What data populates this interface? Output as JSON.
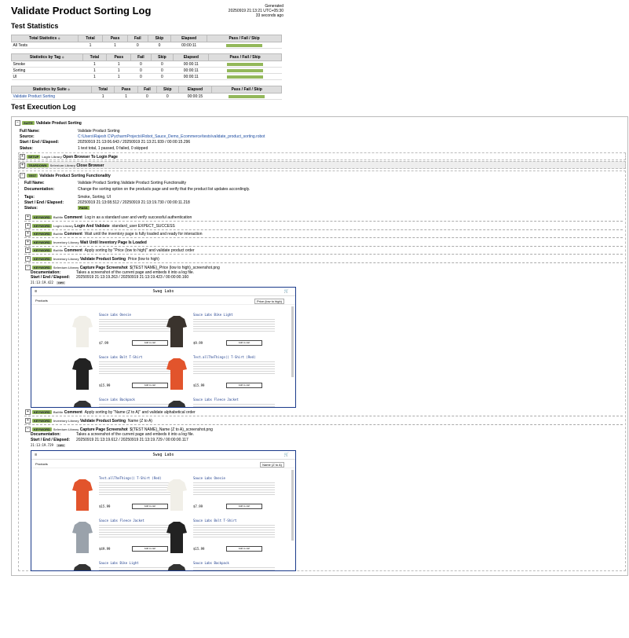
{
  "page": {
    "title": "Validate Product Sorting Log",
    "generated_label": "Generated",
    "generated_time": "20250919 21:13:21 UTC+05:30",
    "generated_ago": "33 seconds ago"
  },
  "sections": {
    "stats": "Test Statistics",
    "log": "Test Execution Log"
  },
  "stats": {
    "headers": [
      "Total",
      "Pass",
      "Fail",
      "Skip",
      "Elapsed",
      "Pass / Fail / Skip"
    ],
    "total": {
      "title": "Total Statistics",
      "rows": [
        {
          "name": "All Tests",
          "total": "1",
          "pass": "1",
          "fail": "0",
          "skip": "0",
          "elapsed": "00:00:11"
        }
      ]
    },
    "tag": {
      "title": "Statistics by Tag",
      "rows": [
        {
          "name": "Smoke",
          "total": "1",
          "pass": "1",
          "fail": "0",
          "skip": "0",
          "elapsed": "00:00:11"
        },
        {
          "name": "Sorting",
          "total": "1",
          "pass": "1",
          "fail": "0",
          "skip": "0",
          "elapsed": "00:00:11"
        },
        {
          "name": "UI",
          "total": "1",
          "pass": "1",
          "fail": "0",
          "skip": "0",
          "elapsed": "00:00:11"
        }
      ]
    },
    "suite": {
      "title": "Statistics by Suite",
      "rows": [
        {
          "name": "Validate Product Sorting",
          "total": "1",
          "pass": "1",
          "fail": "0",
          "skip": "0",
          "elapsed": "00:00:15"
        }
      ]
    },
    "bar_color": "#93b85a"
  },
  "suite": {
    "label": "SUITE",
    "name": "Validate Product Sorting",
    "full_name_label": "Full Name:",
    "full_name": "Validate Product Sorting",
    "source_label": "Source:",
    "source": "C:\\Users\\Rajesh C\\PycharmProjects\\Robot_Sauce_Demo_Ecommerce\\tests\\validate_product_sorting.robot",
    "time_label": "Start / End / Elapsed:",
    "time": "20250919 21:13:06.643 / 20250919 21:13:21.939 / 00:00:15.296",
    "status_label": "Status:",
    "status": "1 test total, 1 passed, 0 failed, 0 skipped",
    "setup": {
      "label": "SETUP",
      "lib": "Login Library",
      "name": "Open Browser To Login Page"
    },
    "teardown": {
      "label": "TEARDOWN",
      "lib": "Selenium Library",
      "name": "Close Browser"
    }
  },
  "test": {
    "label": "TEST",
    "name": "Validate Product Sorting Functionality",
    "full_name_label": "Full Name:",
    "full_name": "Validate Product Sorting.Validate Product Sorting Functionality",
    "doc_label": "Documentation:",
    "doc": "Change the sorting option on the products page and verify that the product list updates accordingly.",
    "tags_label": "Tags:",
    "tags": "Smoke, Sorting, UI",
    "time_label": "Start / End / Elapsed:",
    "time": "20250919 21:13:08.512 / 20250919 21:13:19.730 / 00:00:11.218",
    "status_label": "Status:",
    "status": "PASS"
  },
  "keywords": [
    {
      "label": "KEYWORD",
      "lib": "BuiltIn",
      "name": "Comment",
      "args": "Log in as a standard user and verify successful authentication"
    },
    {
      "label": "KEYWORD",
      "lib": "Login Library",
      "name": "Login And Validate",
      "args": "standard_user    EXPECT_SUCCESS"
    },
    {
      "label": "KEYWORD",
      "lib": "BuiltIn",
      "name": "Comment",
      "args": "Wait until the inventory page is fully loaded and ready for interaction"
    },
    {
      "label": "KEYWORD",
      "lib": "Inventory Library",
      "name": "Wait Until Inventory Page Is Loaded",
      "args": ""
    },
    {
      "label": "KEYWORD",
      "lib": "BuiltIn",
      "name": "Comment",
      "args": "Apply sorting by \"Price (low to high)\" and validate product order"
    },
    {
      "label": "KEYWORD",
      "lib": "Inventory Library",
      "name": "Validate Product Sorting",
      "args": "Price (low to high)"
    }
  ],
  "capture1": {
    "label": "KEYWORD",
    "lib": "Selenium Library",
    "name": "Capture Page Screenshot",
    "args": "${TEST NAME}_Price (low to high)_screenshot.png",
    "doc_label": "Documentation:",
    "doc": "Takes a screenshot of the current page and embeds it into a log file.",
    "time_label": "Start / End / Elapsed:",
    "time": "20250919 21:13:19.263 / 20250919 21:13:19.423 / 00:00:00.160",
    "ts": "21:13:19.422",
    "info": "INFO"
  },
  "keywords2": [
    {
      "label": "KEYWORD",
      "lib": "BuiltIn",
      "name": "Comment",
      "args": "Apply sorting by \"Name (Z to A)\" and validate alphabetical order"
    },
    {
      "label": "KEYWORD",
      "lib": "Inventory Library",
      "name": "Validate Product Sorting",
      "args": "Name (Z to A)"
    }
  ],
  "capture2": {
    "label": "KEYWORD",
    "lib": "Selenium Library",
    "name": "Capture Page Screenshot",
    "args": "${TEST NAME}_Name (Z to A)_screenshot.png",
    "doc_label": "Documentation:",
    "doc": "Takes a screenshot of the current page and embeds it into a log file.",
    "time_label": "Start / End / Elapsed:",
    "time": "20250919 21:13:19.612 / 20250919 21:13:19.729 / 00:00:00.117",
    "ts": "21:13:19.729",
    "info": "INFO"
  },
  "shot1": {
    "app": "Swag Labs",
    "heading": "Products",
    "sort": "Price (low to high)",
    "items": [
      {
        "name": "Sauce Labs Onesie",
        "price": "$7.99",
        "btn": "Add to cart",
        "color": "#f1efe8"
      },
      {
        "name": "Sauce Labs Bike Light",
        "price": "$9.99",
        "btn": "Add to cart",
        "color": "#3a332d"
      },
      {
        "name": "Sauce Labs Bolt T-Shirt",
        "price": "$15.99",
        "btn": "Add to cart",
        "color": "#222"
      },
      {
        "name": "Test.allTheThings() T-Shirt (Red)",
        "price": "$15.99",
        "btn": "Add to cart",
        "color": "#e2542c"
      },
      {
        "name": "Sauce Labs Backpack",
        "price": "",
        "btn": "",
        "color": "#333"
      },
      {
        "name": "Sauce Labs Fleece Jacket",
        "price": "",
        "btn": "",
        "color": "#333"
      }
    ]
  },
  "shot2": {
    "app": "Swag Labs",
    "heading": "Products",
    "sort": "Name (Z to A)",
    "items": [
      {
        "name": "Test.allTheThings() T-Shirt (Red)",
        "price": "$15.99",
        "btn": "Add to cart",
        "color": "#e2542c"
      },
      {
        "name": "Sauce Labs Onesie",
        "price": "$7.99",
        "btn": "Add to cart",
        "color": "#f1efe8"
      },
      {
        "name": "Sauce Labs Fleece Jacket",
        "price": "$49.99",
        "btn": "Add to cart",
        "color": "#9aa2ab"
      },
      {
        "name": "Sauce Labs Bolt T-Shirt",
        "price": "$15.99",
        "btn": "Add to cart",
        "color": "#222"
      },
      {
        "name": "Sauce Labs Bike Light",
        "price": "",
        "btn": "",
        "color": "#333"
      },
      {
        "name": "Sauce Labs Backpack",
        "price": "",
        "btn": "",
        "color": "#333"
      }
    ]
  }
}
